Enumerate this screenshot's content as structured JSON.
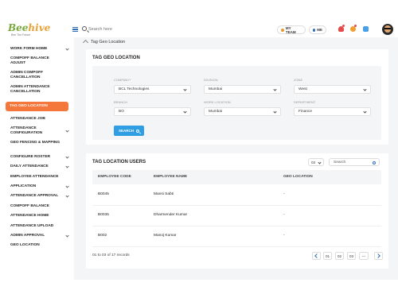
{
  "header": {
    "logo_text_1": "Bee",
    "logo_text_2": "hive",
    "tagline": "Bee The Future",
    "search_placeholder": "Search here",
    "my_team_label": "MY TEAM",
    "me_label": "ME",
    "icons": [
      "menu-icon",
      "search-icon",
      "team-icon",
      "user-icon",
      "bell-icon",
      "badge-icon",
      "calendar-icon"
    ],
    "colors": {
      "accent_blue": "#2f6fb7",
      "accent_orange": "#f4773b",
      "brand_green": "#79a93c"
    }
  },
  "sidebar": {
    "items": [
      {
        "label": "WORK FORM HOME",
        "has_chevron": true
      },
      {
        "label": "COMPOFF BALANCE ADJUST",
        "has_chevron": false
      },
      {
        "label": "ADMIN COMPOFF CANCELLATION",
        "has_chevron": false
      },
      {
        "label": "ADMIN ATTENDANCE CANCELLATION",
        "has_chevron": false
      },
      {
        "label": "TAG GEO LOCATION",
        "has_chevron": false,
        "active": true
      },
      {
        "label": "ATTENDANCE JOB",
        "has_chevron": false
      },
      {
        "label": "ATTENDANCE CONFIGURATION",
        "has_chevron": true
      },
      {
        "label": "GEO FENCING & MAPPING",
        "has_chevron": false
      },
      {
        "label": "CONFIGURE ROSTER",
        "has_chevron": true
      },
      {
        "label": "DAILY ATTENDANCE",
        "has_chevron": true
      },
      {
        "label": "EMPLOYEE ATTENDANCE",
        "has_chevron": false
      },
      {
        "label": "APPLICATION",
        "has_chevron": true
      },
      {
        "label": "ATTENDANCE APPROVAL",
        "has_chevron": true
      },
      {
        "label": "COMPOFF BALANCE",
        "has_chevron": false
      },
      {
        "label": "ATTENDANCE HOME",
        "has_chevron": false
      },
      {
        "label": "ATTENDANCE UPLOAD",
        "has_chevron": false
      },
      {
        "label": "ADMIN APPROVAL",
        "has_chevron": true
      },
      {
        "label": "GEO LOCATION",
        "has_chevron": false
      }
    ]
  },
  "breadcrumb": {
    "label": "Tag Geo Location"
  },
  "filter": {
    "title": "TAG GEO LOCATION",
    "company_label": "COMPANY*",
    "company_value": "BCL Technologies",
    "division_label": "DIVISION",
    "division_value": "Mumbai",
    "zone_label": "ZONE",
    "zone_value": "West",
    "branch_label": "BRANCH",
    "branch_value": "BO",
    "work_location_label": "WORK LOCATION",
    "work_location_value": "Mumbai",
    "department_label": "DEPARTMENT",
    "department_value": "Finance",
    "search_button": "SEARCH"
  },
  "table": {
    "title": "TAG LOCATION USERS",
    "page_size": "03",
    "search_placeholder": "Search",
    "columns": [
      "EMPLOYEE CODE",
      "EMPLOYEE NAME",
      "GEO LOCATION"
    ],
    "rows": [
      {
        "code": "B0045",
        "name": "Mansi Sabti",
        "geo": "-"
      },
      {
        "code": "B0035",
        "name": "Dharmender Kumar",
        "geo": "-"
      },
      {
        "code": "B002",
        "name": "Manoj Kumar",
        "geo": "-"
      }
    ],
    "records_text": "01 to 03 of 17 records",
    "pages": [
      "01",
      "02",
      "03",
      "---"
    ]
  }
}
